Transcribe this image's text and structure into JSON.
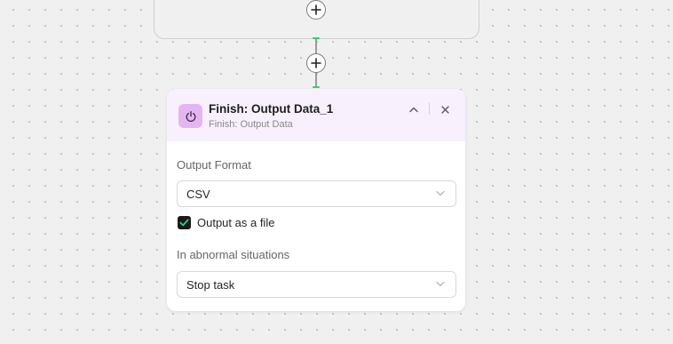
{
  "canvas": {
    "add_step_icon": "plus-icon"
  },
  "node": {
    "title": "Finish: Output Data_1",
    "subtitle": "Finish: Output Data",
    "icon": "power-icon",
    "icon_color": "#e4b5f3",
    "header_bg": "#f8f0fc",
    "collapse_icon": "chevron-up-icon",
    "close_icon": "close-icon",
    "fields": {
      "output_format_label": "Output Format",
      "output_format_value": "CSV",
      "output_as_file_label": "Output as a file",
      "output_as_file_checked": true,
      "abnormal_label": "In abnormal situations",
      "abnormal_value": "Stop task"
    }
  },
  "colors": {
    "connector_active": "#2ecf7f",
    "checkbox_fill": "#1a1a1a"
  }
}
